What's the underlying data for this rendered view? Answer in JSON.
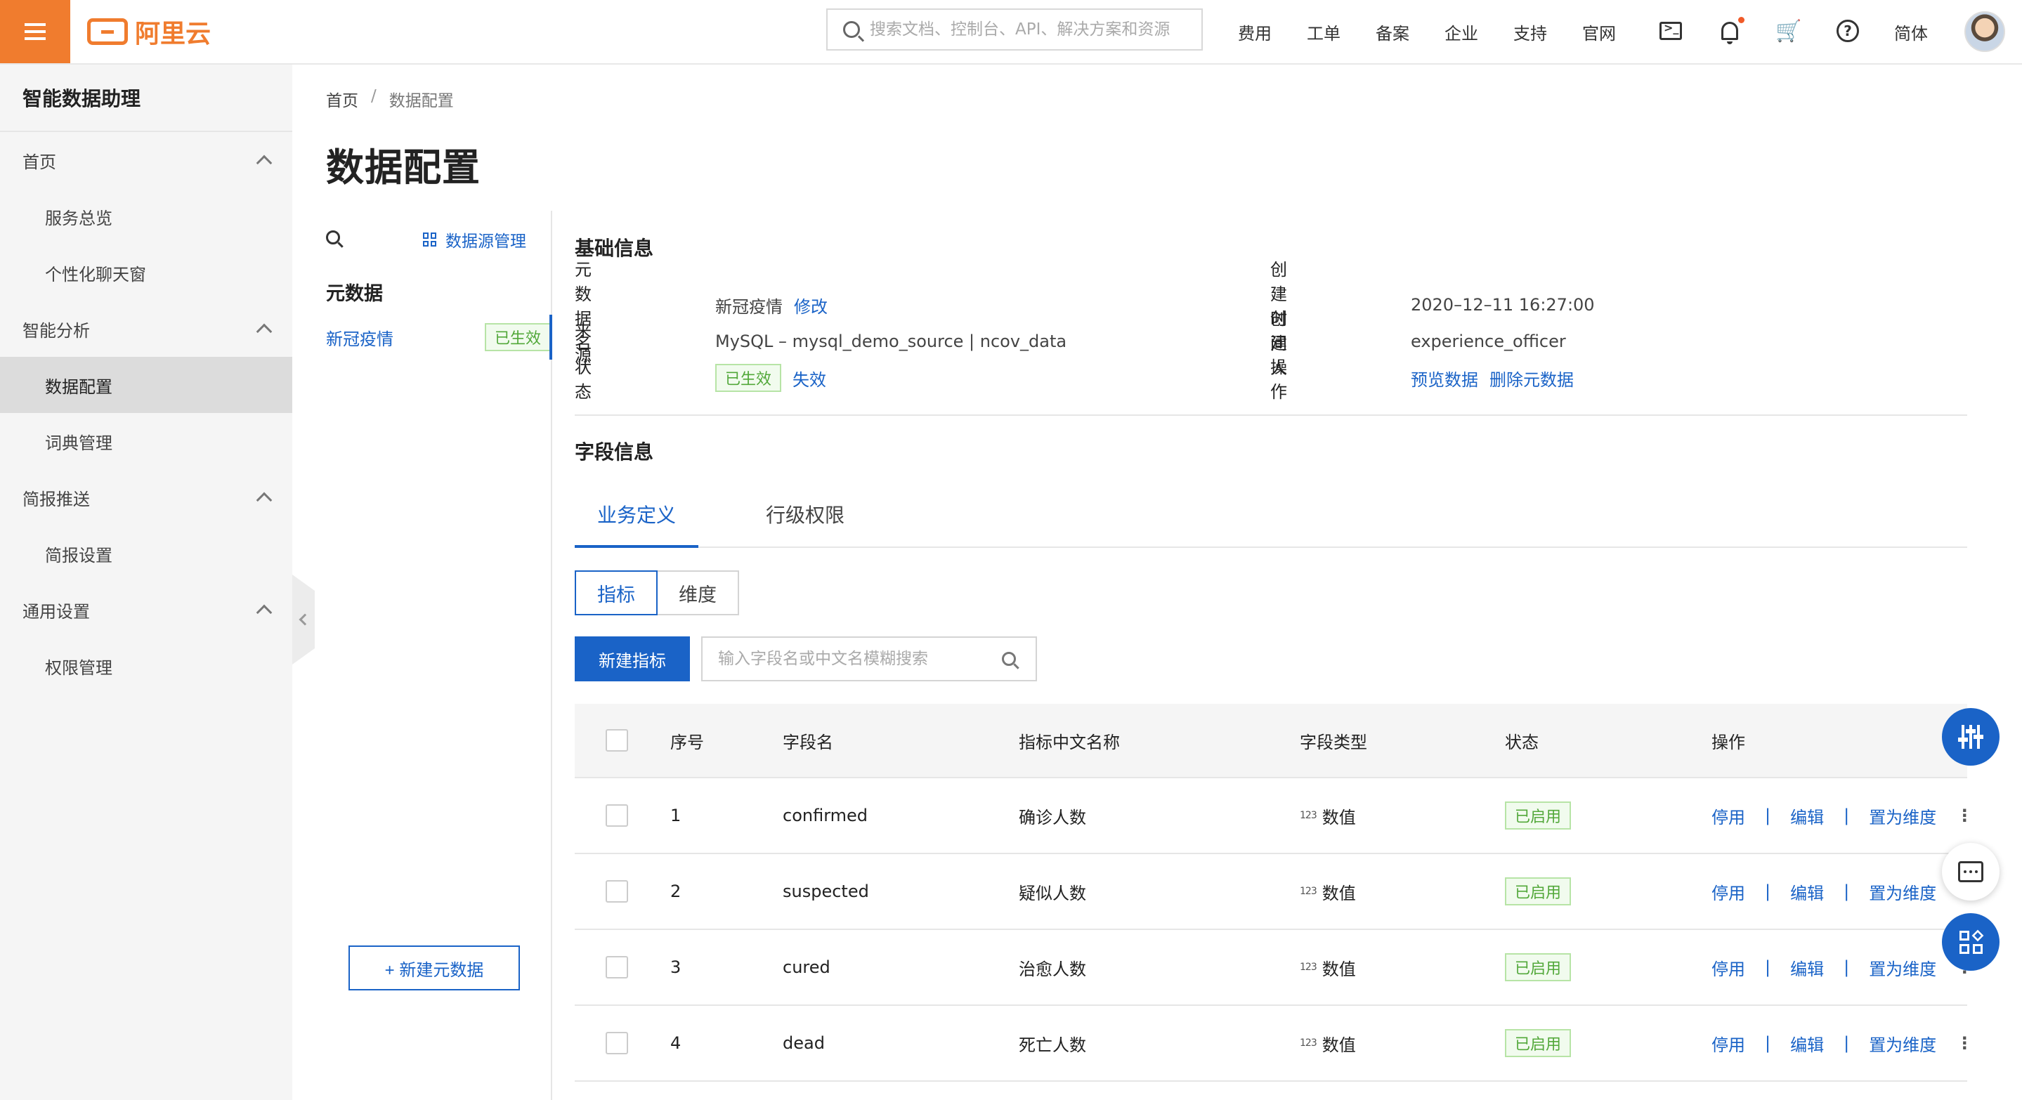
{
  "header": {
    "logo_text": "阿里云",
    "search_placeholder": "搜索文档、控制台、API、解决方案和资源",
    "nav": [
      "费用",
      "工单",
      "备案",
      "企业",
      "支持",
      "官网"
    ],
    "lang": "简体",
    "icons": [
      "menu-icon",
      "terminal-icon",
      "bell-icon",
      "cart-icon",
      "help-icon"
    ]
  },
  "sidebar": {
    "title": "智能数据助理",
    "groups": [
      {
        "label": "首页",
        "items": [
          "服务总览",
          "个性化聊天窗"
        ]
      },
      {
        "label": "智能分析",
        "items": [
          "数据配置",
          "词典管理"
        ]
      },
      {
        "label": "简报推送",
        "items": [
          "简报设置"
        ]
      },
      {
        "label": "通用设置",
        "items": [
          "权限管理"
        ]
      }
    ],
    "active_item": "数据配置"
  },
  "breadcrumb": {
    "home": "首页",
    "sep": "/",
    "current": "数据配置"
  },
  "page_title": "数据配置",
  "meta_panel": {
    "ds_manage": "数据源管理",
    "section": "元数据",
    "item_name": "新冠疫情",
    "item_status": "已生效",
    "new_button": "+ 新建元数据"
  },
  "basic_info": {
    "title": "基础信息",
    "name_label": "元数据名",
    "name_value": "新冠疫情",
    "name_action": "修改",
    "source_label": "来源",
    "source_value": "MySQL – mysql_demo_source | ncov_data",
    "status_label": "状态",
    "status_value": "已生效",
    "status_action": "失效",
    "created_label": "创建时间",
    "created_value": "2020–12–11 16:27:00",
    "creator_label": "创建人",
    "creator_value": "experience_officer",
    "ops_label": "操作",
    "op_preview": "预览数据",
    "op_delete": "删除元数据"
  },
  "field_info": {
    "title": "字段信息",
    "tabs": [
      "业务定义",
      "行级权限"
    ],
    "segments": [
      "指标",
      "维度"
    ],
    "new_button": "新建指标",
    "search_placeholder": "输入字段名或中文名模糊搜索"
  },
  "table": {
    "headers": {
      "index": "序号",
      "field": "字段名",
      "cn_name": "指标中文名称",
      "type": "字段类型",
      "status": "状态",
      "ops": "操作"
    },
    "type_icon": "123",
    "rows": [
      {
        "index": "1",
        "field": "confirmed",
        "cn_name": "确诊人数",
        "type": "数值",
        "status": "已启用"
      },
      {
        "index": "2",
        "field": "suspected",
        "cn_name": "疑似人数",
        "type": "数值",
        "status": "已启用"
      },
      {
        "index": "3",
        "field": "cured",
        "cn_name": "治愈人数",
        "type": "数值",
        "status": "已启用"
      },
      {
        "index": "4",
        "field": "dead",
        "cn_name": "死亡人数",
        "type": "数值",
        "status": "已启用"
      }
    ],
    "op_disable": "停用",
    "op_edit": "编辑",
    "op_set_dim": "置为维度",
    "op_sep": "|",
    "op_more": "⋮"
  },
  "colors": {
    "accent": "#1a63c7",
    "brand": "#f07c2e",
    "success": "#52a83a"
  }
}
